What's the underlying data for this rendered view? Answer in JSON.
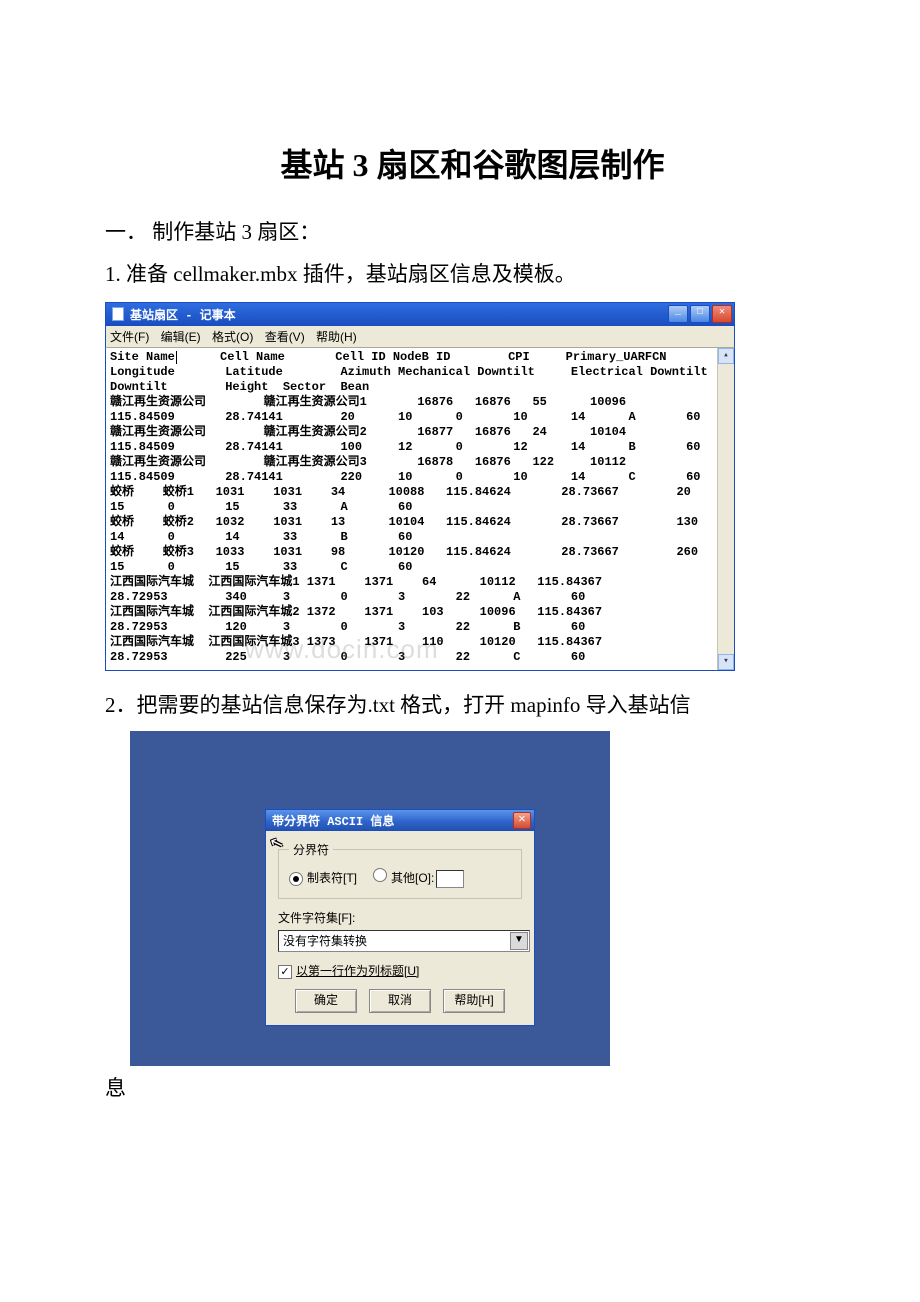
{
  "title": "基站 3 扇区和谷歌图层制作",
  "section1": "一．  制作基站 3 扇区：",
  "step1": "1. 准备 cellmaker.mbx 插件，基站扇区信息及模板。",
  "step2": "2．把需要的基站信息保存为.txt 格式，打开 mapinfo 导入基站信",
  "trail": "息",
  "notepad": {
    "window_title": "基站扇区 - 记事本",
    "menus": [
      "文件(F)",
      "编辑(E)",
      "格式(O)",
      "查看(V)",
      "帮助(H)"
    ],
    "content": "Site Name|\tCell Name\tCell ID\tNodeB ID\tCPI\tPrimary_UARFCN\nLongitude\tLatitude\tAzimuth\tMechanical Downtilt\tElectrical Downtilt\nDowntilt\tHeight\tSector\tBean\n赣江再生资源公司\t赣江再生资源公司1\t16876\t16876\t55\t10096\n115.84509\t28.74141\t20\t10\t0\t10\t14\tA\t60\n赣江再生资源公司\t赣江再生资源公司2\t16877\t16876\t24\t10104\n115.84509\t28.74141\t100\t12\t0\t12\t14\tB\t60\n赣江再生资源公司\t赣江再生资源公司3\t16878\t16876\t122\t10112\n115.84509\t28.74141\t220\t10\t0\t10\t14\tC\t60\n蛟桥\t蛟桥1\t1031\t1031\t34\t10088\t115.84624\t28.73667\t20\n15\t0\t15\t33\tA\t60\n蛟桥\t蛟桥2\t1032\t1031\t13\t10104\t115.84624\t28.73667\t130\n14\t0\t14\t33\tB\t60\n蛟桥\t蛟桥3\t1033\t1031\t98\t10120\t115.84624\t28.73667\t260\n15\t0\t15\t33\tC\t60\n江西国际汽车城\t江西国际汽车城1\t1371\t1371\t64\t10112\t115.84367\n28.72953\t340\t3\t0\t3\t22\tA\t60\n江西国际汽车城\t江西国际汽车城2\t1372\t1371\t103\t10096\t115.84367\n28.72953\t120\t3\t0\t3\t22\tB\t60\n江西国际汽车城\t江西国际汽车城3\t1373\t1371\t110\t10120\t115.84367\n28.72953\t225\t3\t0\t3\t22\tC\t60"
  },
  "dialog": {
    "title": "带分界符 ASCII 信息",
    "legend": "分界符",
    "radio_tab": "制表符[T]",
    "radio_other": "其他[O]:",
    "charset_label": "文件字符集[F]:",
    "charset_value": "没有字符集转换",
    "first_row": "以第一行作为列标题[U]",
    "ok": "确定",
    "cancel": "取消",
    "help": "帮助[H]"
  }
}
